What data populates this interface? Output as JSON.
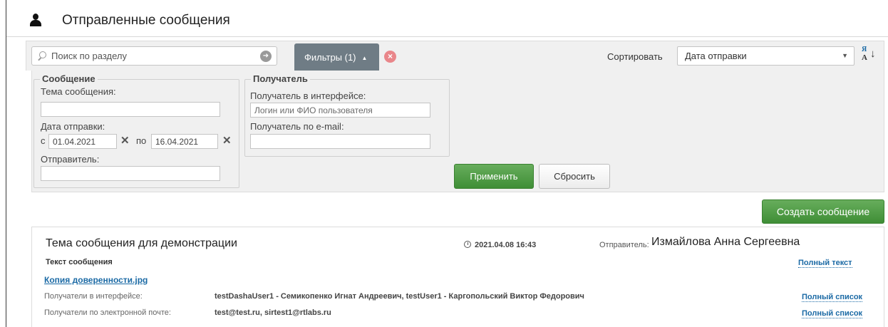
{
  "header": {
    "title": "Отправленные сообщения",
    "icon": "user-icon"
  },
  "toolbar": {
    "search_placeholder": "Поиск по разделу",
    "filters_label": "Фильтры (1)",
    "sort_label": "Сортировать",
    "sort_value": "Дата отправки",
    "sort_dir_top": "Я",
    "sort_dir_bottom": "А",
    "sort_dir_arrow": "↓"
  },
  "filters": {
    "message": {
      "legend": "Сообщение",
      "subject_label": "Тема сообщения:",
      "subject_value": "",
      "date_label": "Дата отправки:",
      "date_from_prefix": "с",
      "date_from": "01.04.2021",
      "date_to_prefix": "по",
      "date_to": "16.04.2021",
      "sender_label": "Отправитель:",
      "sender_value": ""
    },
    "recipient": {
      "legend": "Получатель",
      "ui_label": "Получатель в интерфейсе:",
      "ui_placeholder": "Логин или ФИО пользователя",
      "email_label": "Получатель по e-mail:",
      "email_value": ""
    },
    "apply_label": "Применить",
    "reset_label": "Сбросить"
  },
  "create_label": "Создать сообщение",
  "message_card": {
    "subject": "Тема сообщения для демонстрации",
    "date": "2021.04.08 16:43",
    "sender_label": "Отправитель:",
    "sender_name": "Измайлова Анна Сергеевна",
    "body_label": "Текст сообщения",
    "full_text_link": "Полный текст",
    "attachment": "Копия доверенности.jpg",
    "ui_recipients_label": "Получатели в интерфейсе:",
    "ui_recipients_value": "testDashaUser1 - Семикопенко Игнат Андреевич, testUser1 - Каргопольский Виктор Федорович",
    "email_recipients_label": "Получатели по электронной почте:",
    "email_recipients_value": "test@test.ru, sirtest1@rtlabs.ru",
    "full_list_link": "Полный список"
  },
  "colors": {
    "primary_green": "#4a9a40",
    "filter_tab": "#6f7c85",
    "link": "#1b6aa5",
    "clear_red": "#e9868a"
  }
}
